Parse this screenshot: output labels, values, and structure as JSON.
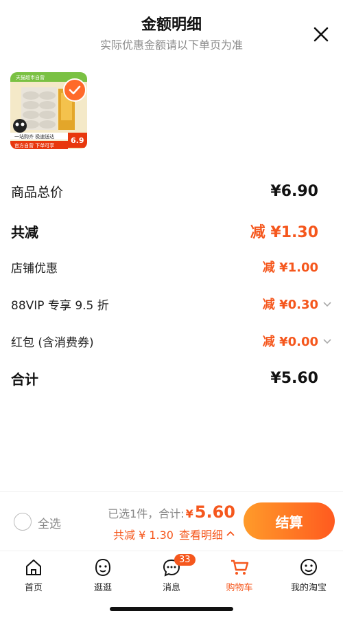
{
  "header": {
    "title": "金额明细",
    "subtitle": "实际优惠金额请以下单页为准"
  },
  "product": {
    "image_top_label": "天猫超市自营",
    "image_slogan": "一站购齐 极速送达",
    "image_footer": "官方自营 下单可享",
    "image_price": "6.9"
  },
  "rows": [
    {
      "label": "商品总价",
      "amount": "¥6.90"
    },
    {
      "label": "共减",
      "amount": "减 ¥1.30"
    },
    {
      "label": "店铺优惠",
      "amount": "减 ¥1.00"
    },
    {
      "label": "88VIP 专享 9.5 折",
      "amount": "减 ¥0.30"
    },
    {
      "label": "红包 (含消费券)",
      "amount": "减 ¥0.00"
    },
    {
      "label": "合计",
      "amount": "¥5.60"
    }
  ],
  "footer": {
    "select_all": "全选",
    "selected_text": "已选1件，合计:",
    "total_symbol": "¥",
    "total_value": "5.60",
    "reduced_text": "共减 ¥ 1.30",
    "view_detail": "查看明细",
    "checkout": "结算"
  },
  "tabs": [
    {
      "label": "首页"
    },
    {
      "label": "逛逛"
    },
    {
      "label": "消息",
      "badge": "33"
    },
    {
      "label": "购物车"
    },
    {
      "label": "我的淘宝"
    }
  ],
  "colors": {
    "accent": "#f5571d"
  }
}
